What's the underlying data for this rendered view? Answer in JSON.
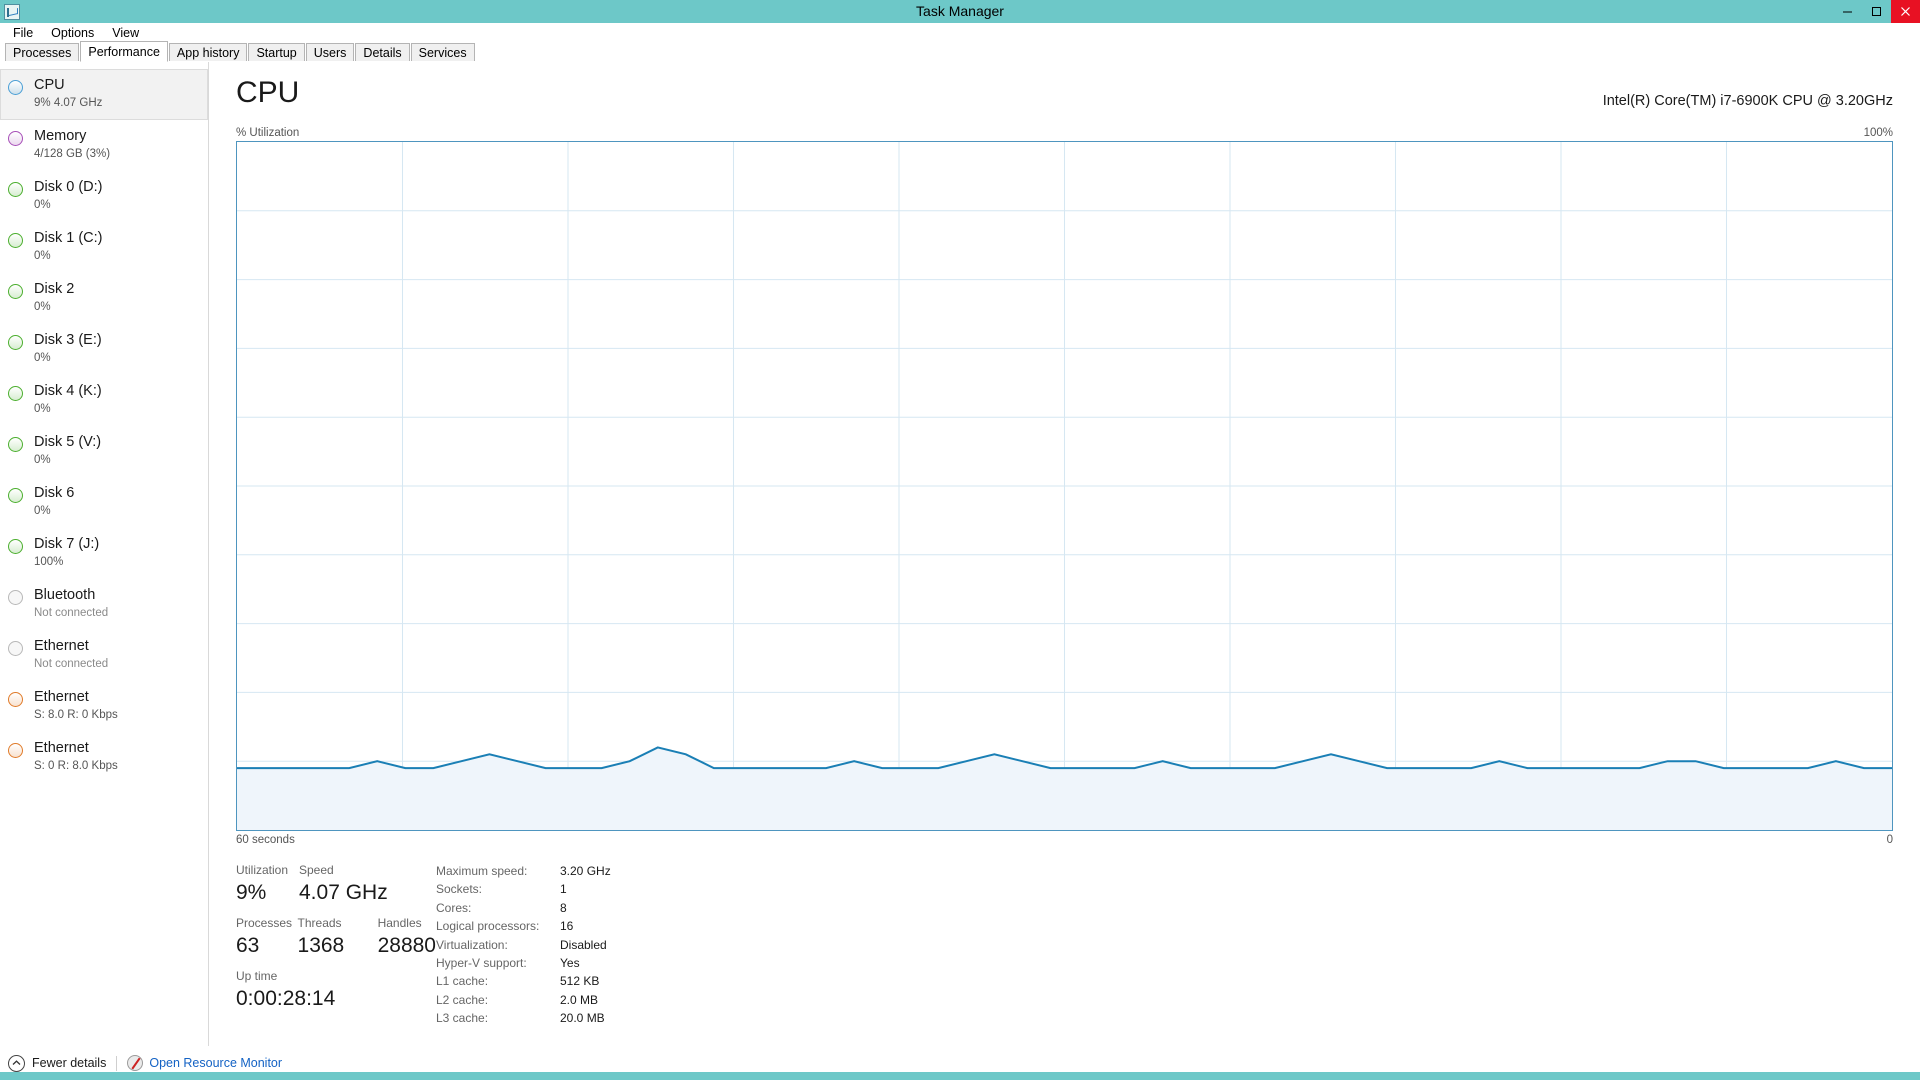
{
  "window": {
    "title": "Task Manager",
    "icon": "task-manager-icon",
    "minimize_label": "–",
    "maximize_label": "□",
    "close_label": "✕",
    "titlebar_color": "#6dc8c8"
  },
  "menu": [
    {
      "label": "File"
    },
    {
      "label": "Options"
    },
    {
      "label": "View"
    }
  ],
  "tabs": [
    {
      "label": "Processes",
      "active": false
    },
    {
      "label": "Performance",
      "active": true
    },
    {
      "label": "App history",
      "active": false
    },
    {
      "label": "Startup",
      "active": false
    },
    {
      "label": "Users",
      "active": false
    },
    {
      "label": "Details",
      "active": false
    },
    {
      "label": "Services",
      "active": false
    }
  ],
  "sidebar": {
    "items": [
      {
        "title": "CPU",
        "sub": "9%  4.07 GHz",
        "color": "#4b9fd5",
        "selected": true,
        "dim": false
      },
      {
        "title": "Memory",
        "sub": "4/128 GB (3%)",
        "color": "#a74fb8",
        "selected": false,
        "dim": false
      },
      {
        "title": "Disk 0 (D:)",
        "sub": "0%",
        "color": "#4caf2f",
        "selected": false,
        "dim": false
      },
      {
        "title": "Disk 1 (C:)",
        "sub": "0%",
        "color": "#4caf2f",
        "selected": false,
        "dim": false
      },
      {
        "title": "Disk 2",
        "sub": "0%",
        "color": "#4caf2f",
        "selected": false,
        "dim": false
      },
      {
        "title": "Disk 3 (E:)",
        "sub": "0%",
        "color": "#4caf2f",
        "selected": false,
        "dim": false
      },
      {
        "title": "Disk 4 (K:)",
        "sub": "0%",
        "color": "#4caf2f",
        "selected": false,
        "dim": false
      },
      {
        "title": "Disk 5 (V:)",
        "sub": "0%",
        "color": "#4caf2f",
        "selected": false,
        "dim": false
      },
      {
        "title": "Disk 6",
        "sub": "0%",
        "color": "#4caf2f",
        "selected": false,
        "dim": false
      },
      {
        "title": "Disk 7 (J:)",
        "sub": "100%",
        "color": "#4caf2f",
        "selected": false,
        "dim": false
      },
      {
        "title": "Bluetooth",
        "sub": "Not connected",
        "color": "#b8b8b8",
        "selected": false,
        "dim": true
      },
      {
        "title": "Ethernet",
        "sub": "Not connected",
        "color": "#b8b8b8",
        "selected": false,
        "dim": true
      },
      {
        "title": "Ethernet",
        "sub": "S: 8.0 R: 0 Kbps",
        "color": "#e07b2a",
        "selected": false,
        "dim": false
      },
      {
        "title": "Ethernet",
        "sub": "S: 0 R: 8.0 Kbps",
        "color": "#e07b2a",
        "selected": false,
        "dim": false
      }
    ]
  },
  "main": {
    "heading": "CPU",
    "cpu_model": "Intel(R) Core(TM) i7-6900K CPU @ 3.20GHz",
    "graph_top_left_label": "% Utilization",
    "graph_top_right_label": "100%",
    "graph_bottom_left_label": "60 seconds",
    "graph_bottom_right_label": "0"
  },
  "chart_data": {
    "type": "area",
    "title": "% Utilization",
    "xlabel": "60 seconds",
    "ylabel": "% Utilization",
    "ylim": [
      0,
      100
    ],
    "xlim": [
      60,
      0
    ],
    "grid": true,
    "line_color": "#1a7fb5",
    "fill_color": "#eff5fb",
    "x_axis_right_label": "0",
    "y_axis_top_label": "100%",
    "series": [
      {
        "name": "CPU utilization",
        "values": [
          9,
          9,
          9,
          9,
          9,
          10,
          9,
          9,
          10,
          11,
          10,
          9,
          9,
          9,
          10,
          12,
          11,
          9,
          9,
          9,
          9,
          9,
          10,
          9,
          9,
          9,
          10,
          11,
          10,
          9,
          9,
          9,
          9,
          10,
          9,
          9,
          9,
          9,
          10,
          11,
          10,
          9,
          9,
          9,
          9,
          10,
          9,
          9,
          9,
          9,
          9,
          10,
          10,
          9,
          9,
          9,
          9,
          10,
          9,
          9
        ]
      }
    ]
  },
  "stats": {
    "utilization_label": "Utilization",
    "utilization_value": "9%",
    "speed_label": "Speed",
    "speed_value": "4.07 GHz",
    "processes_label": "Processes",
    "processes_value": "63",
    "threads_label": "Threads",
    "threads_value": "1368",
    "handles_label": "Handles",
    "handles_value": "28880",
    "uptime_label": "Up time",
    "uptime_value": "0:00:28:14"
  },
  "sysinfo": [
    {
      "key": "Maximum speed:",
      "value": "3.20 GHz"
    },
    {
      "key": "Sockets:",
      "value": "1"
    },
    {
      "key": "Cores:",
      "value": "8"
    },
    {
      "key": "Logical processors:",
      "value": "16"
    },
    {
      "key": "Virtualization:",
      "value": "Disabled"
    },
    {
      "key": "Hyper-V support:",
      "value": "Yes"
    },
    {
      "key": "L1 cache:",
      "value": "512 KB"
    },
    {
      "key": "L2 cache:",
      "value": "2.0 MB"
    },
    {
      "key": "L3 cache:",
      "value": "20.0 MB"
    }
  ],
  "footer": {
    "fewer_details_label": "Fewer details",
    "resource_monitor_label": "Open Resource Monitor"
  }
}
